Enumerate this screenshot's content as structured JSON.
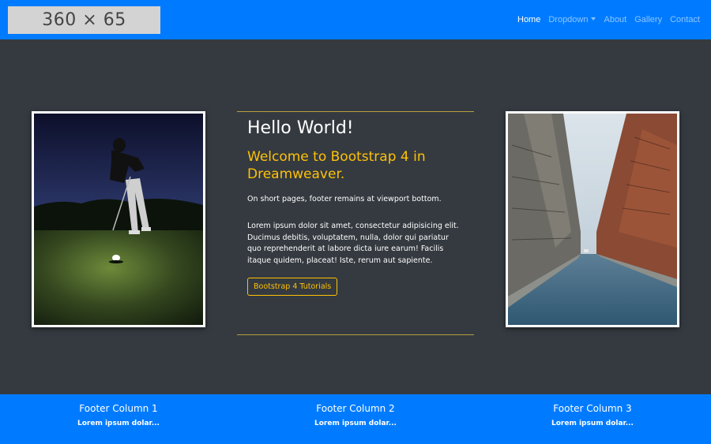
{
  "navbar": {
    "brand_placeholder": "360 × 65",
    "items": [
      {
        "label": "Home",
        "active": true
      },
      {
        "label": "Dropdown",
        "has_caret": true
      },
      {
        "label": "About"
      },
      {
        "label": "Gallery"
      },
      {
        "label": "Contact"
      }
    ],
    "background": "#007bff"
  },
  "main": {
    "heading": "Hello World!",
    "subheading": "Welcome to Bootstrap 4 in Dreamweaver.",
    "note": "On short pages, footer remains at viewport bottom.",
    "body": "Lorem ipsum dolor sit amet, consectetur adipisicing elit. Ducimus debitis, voluptatem, nulla, dolor qui pariatur quo reprehenderit at labore dicta iure earum! Facilis itaque quidem, placeat! Iste, rerum aut sapiente.",
    "button_label": "Bootstrap 4 Tutorials",
    "accent": "#ffc107",
    "background": "#343a40"
  },
  "images": {
    "left": "golfer-photo",
    "right": "city-street-photo"
  },
  "footer": {
    "columns": [
      {
        "title": "Footer Column 1",
        "text": "Lorem ipsum dolar..."
      },
      {
        "title": "Footer Column 2",
        "text": "Lorem ipsum dolar..."
      },
      {
        "title": "Footer Column 3",
        "text": "Lorem ipsum dolar..."
      }
    ]
  }
}
